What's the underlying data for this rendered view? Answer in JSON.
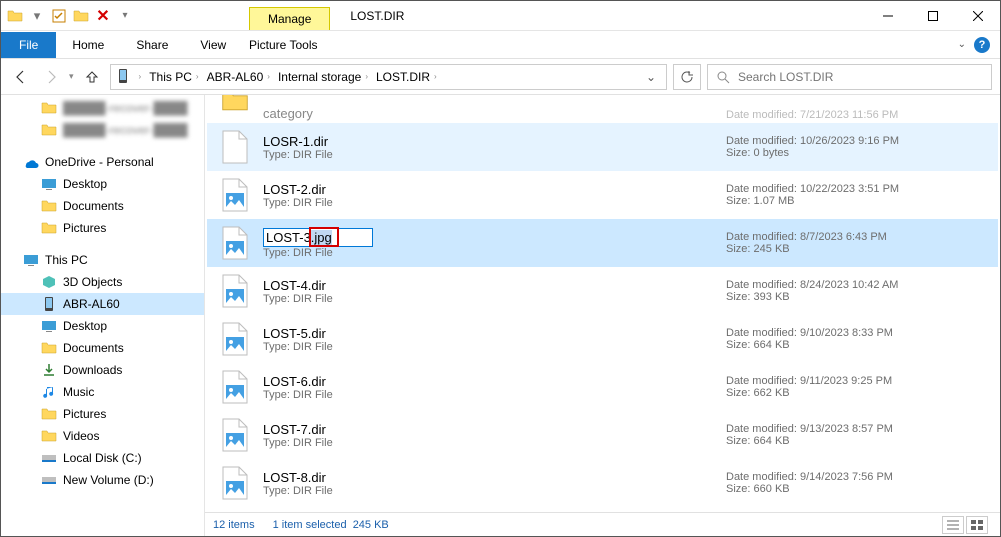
{
  "window": {
    "title": "LOST.DIR"
  },
  "title_tabs": {
    "manage": "Manage",
    "picture_tools": "Picture Tools"
  },
  "ribbon": {
    "file": "File",
    "home": "Home",
    "share": "Share",
    "view": "View"
  },
  "breadcrumbs": [
    "This PC",
    "ABR-AL60",
    "Internal storage",
    "LOST.DIR"
  ],
  "search": {
    "placeholder": "Search LOST.DIR"
  },
  "nav": {
    "recent1": "█████-recover-████",
    "recent2": "█████-recover-████",
    "onedrive": "OneDrive - Personal",
    "od_desktop": "Desktop",
    "od_documents": "Documents",
    "od_pictures": "Pictures",
    "thispc": "This PC",
    "objects3d": "3D Objects",
    "abr": "ABR-AL60",
    "desktop": "Desktop",
    "documents": "Documents",
    "downloads": "Downloads",
    "music": "Music",
    "pictures": "Pictures",
    "videos": "Videos",
    "c": "Local Disk (C:)",
    "d": "New Volume (D:)"
  },
  "partial_row": {
    "name": "category",
    "date_label": "Date modified:",
    "date": "7/21/2023 11:56 PM"
  },
  "files": [
    {
      "name": "LOSR-1.dir",
      "type": "DIR File",
      "date": "10/26/2023 9:16 PM",
      "size": "0 bytes",
      "icon": "blank",
      "state": "hov"
    },
    {
      "name": "LOST-2.dir",
      "type": "DIR File",
      "date": "10/22/2023 3:51 PM",
      "size": "1.07 MB",
      "icon": "img",
      "state": ""
    },
    {
      "name": "LOST-3",
      "ext": ".jpg",
      "type": "DIR File",
      "date": "8/7/2023 6:43 PM",
      "size": "245 KB",
      "icon": "img",
      "state": "sel",
      "renaming": true
    },
    {
      "name": "LOST-4.dir",
      "type": "DIR File",
      "date": "8/24/2023 10:42 AM",
      "size": "393 KB",
      "icon": "img",
      "state": ""
    },
    {
      "name": "LOST-5.dir",
      "type": "DIR File",
      "date": "9/10/2023 8:33 PM",
      "size": "664 KB",
      "icon": "img",
      "state": ""
    },
    {
      "name": "LOST-6.dir",
      "type": "DIR File",
      "date": "9/11/2023 9:25 PM",
      "size": "662 KB",
      "icon": "img",
      "state": ""
    },
    {
      "name": "LOST-7.dir",
      "type": "DIR File",
      "date": "9/13/2023 8:57 PM",
      "size": "664 KB",
      "icon": "img",
      "state": ""
    },
    {
      "name": "LOST-8.dir",
      "type": "DIR File",
      "date": "9/14/2023 7:56 PM",
      "size": "660 KB",
      "icon": "img",
      "state": ""
    }
  ],
  "meta_labels": {
    "date": "Date modified:",
    "size": "Size:",
    "type_prefix": "Type:"
  },
  "status": {
    "count": "12 items",
    "selected": "1 item selected",
    "size": "245 KB"
  }
}
